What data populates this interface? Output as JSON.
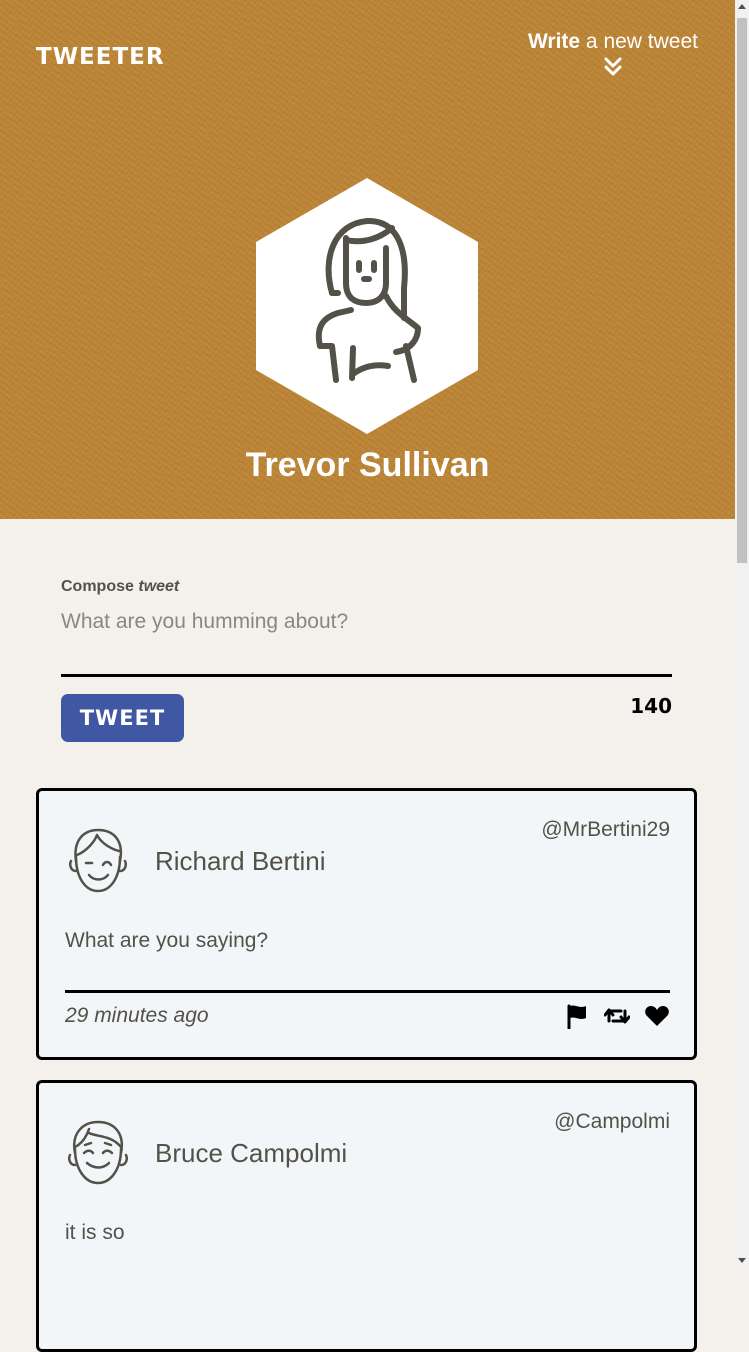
{
  "nav": {
    "brand": "TWEETER",
    "write_bold": "Write",
    "write_rest": " a new tweet"
  },
  "profile": {
    "name": "Trevor Sullivan"
  },
  "compose": {
    "label_bold": "Compose",
    "label_italic": "tweet",
    "placeholder": "What are you humming about?",
    "button_label": "TWEET",
    "counter": "140"
  },
  "tweets": [
    {
      "name": "Richard Bertini",
      "handle": "@MrBertini29",
      "text": "What are you saying?",
      "time": "29 minutes ago"
    },
    {
      "name": "Bruce Campolmi",
      "handle": "@Campolmi",
      "text": "it is so",
      "time": ""
    }
  ],
  "colors": {
    "hero_bg": "#bd8638",
    "page_bg": "#f4f1ec",
    "button": "#4057a4",
    "card_bg": "#f3f6f9",
    "text": "#545149"
  },
  "icons": {
    "write_chevron": "double-chevron-down-icon",
    "flag": "flag-icon",
    "retweet": "retweet-icon",
    "like": "heart-icon"
  }
}
